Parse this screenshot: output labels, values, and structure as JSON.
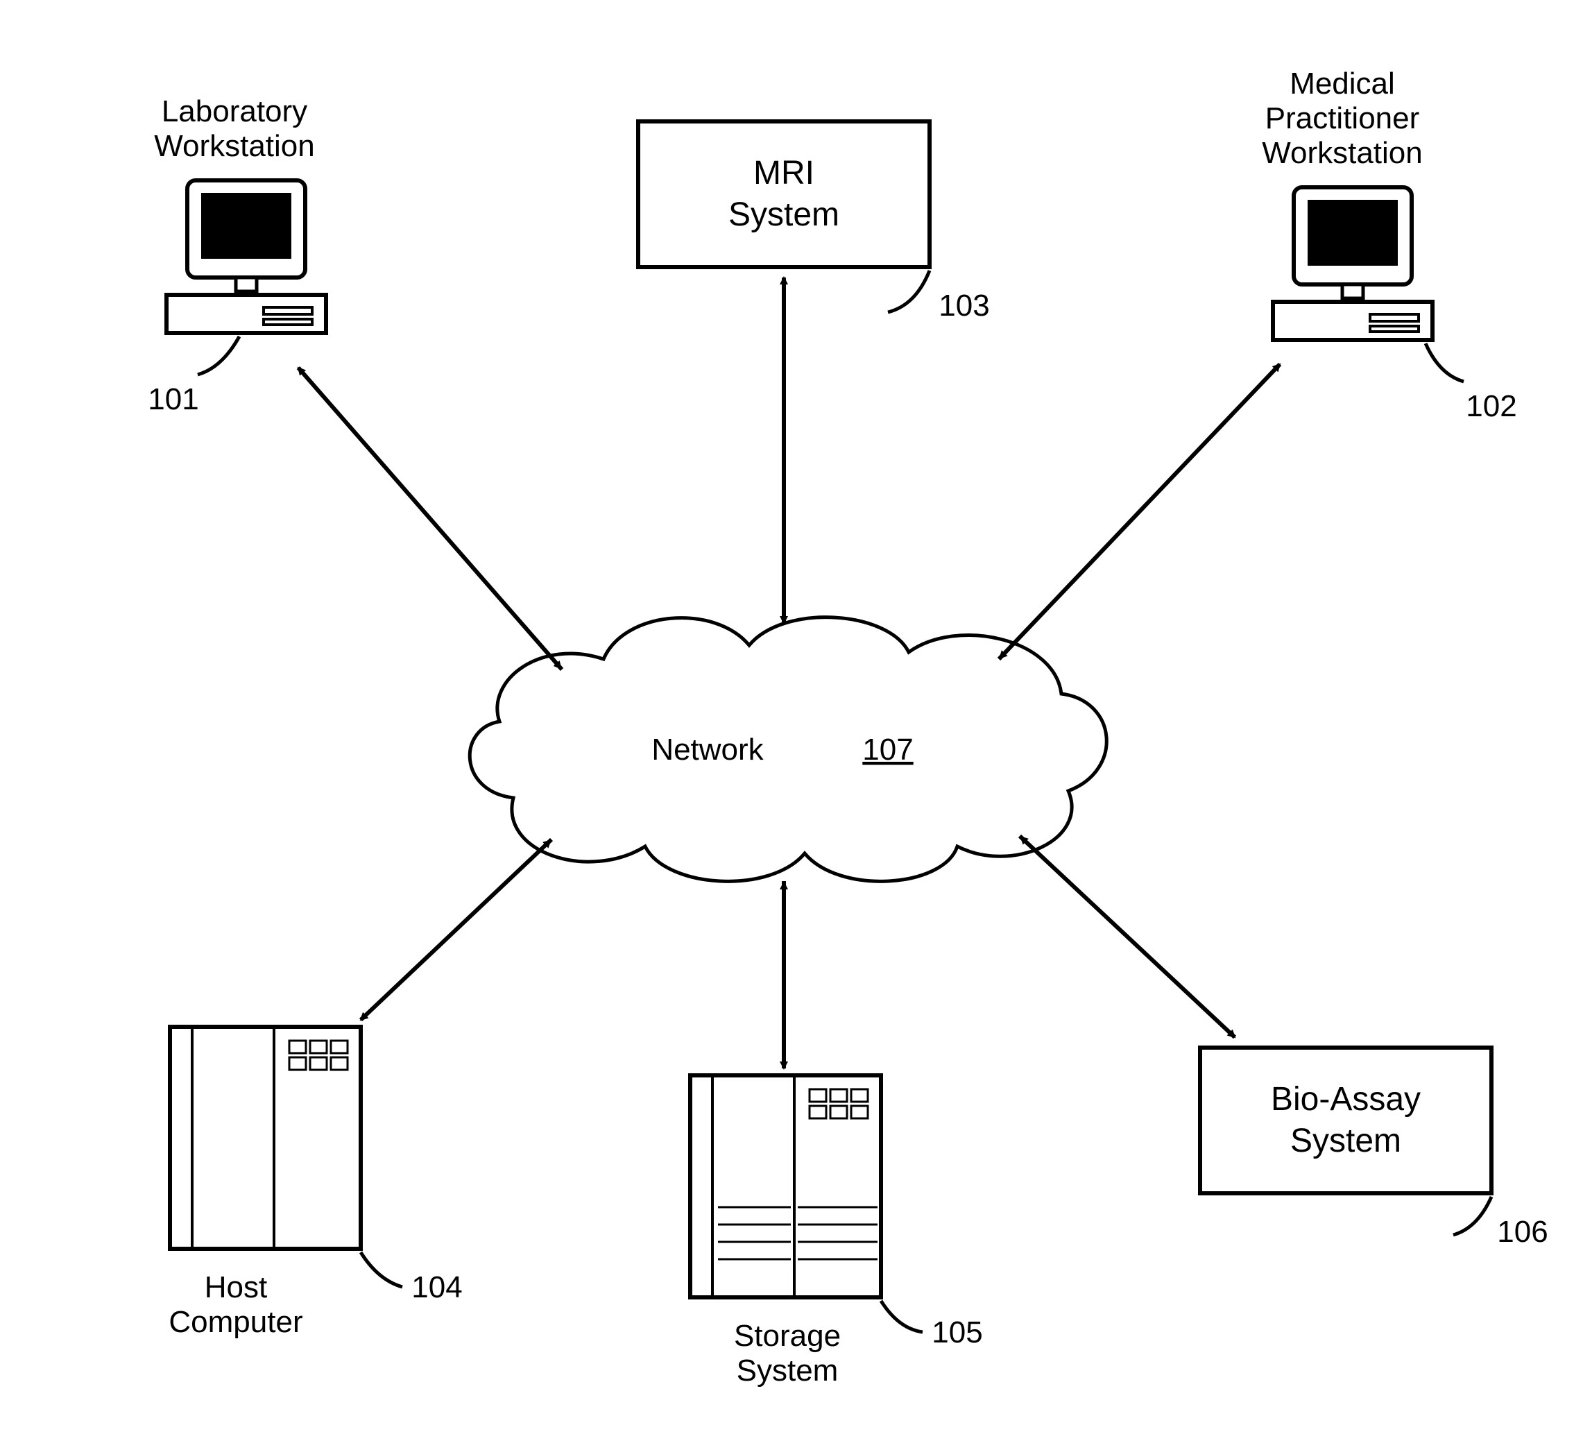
{
  "nodes": {
    "lab": {
      "title1": "Laboratory",
      "title2": "Workstation",
      "ref": "101"
    },
    "mri": {
      "title1": "MRI",
      "title2": "System",
      "ref": "103"
    },
    "med": {
      "title1": "Medical",
      "title2": "Practitioner",
      "title3": "Workstation",
      "ref": "102"
    },
    "host": {
      "title1": "Host",
      "title2": "Computer",
      "ref": "104"
    },
    "storage": {
      "title1": "Storage",
      "title2": "System",
      "ref": "105"
    },
    "bioassay": {
      "title1": "Bio-Assay",
      "title2": "System",
      "ref": "106"
    },
    "network": {
      "title": "Network",
      "ref": "107"
    }
  }
}
